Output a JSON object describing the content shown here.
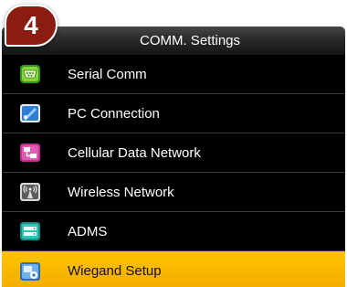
{
  "step_badge": "4",
  "header": {
    "title": "COMM. Settings"
  },
  "colors": {
    "selected_row": "#f5b300",
    "badge": "#8a1c12",
    "background": "#000000"
  },
  "menu": {
    "items": [
      {
        "label": "Serial Comm",
        "icon": "serial-port-icon",
        "selected": false
      },
      {
        "label": "PC Connection",
        "icon": "pc-connection-icon",
        "selected": false
      },
      {
        "label": "Cellular Data Network",
        "icon": "cellular-network-icon",
        "selected": false
      },
      {
        "label": "Wireless Network",
        "icon": "wireless-antenna-icon",
        "selected": false
      },
      {
        "label": "ADMS",
        "icon": "adms-server-icon",
        "selected": false
      },
      {
        "label": "Wiegand Setup",
        "icon": "wiegand-setup-icon",
        "selected": true
      }
    ]
  }
}
